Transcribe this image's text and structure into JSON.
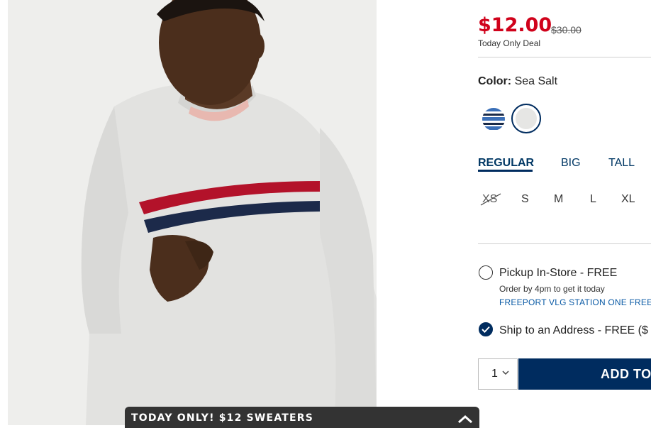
{
  "product": {
    "image_alt": "man wearing light gray crew-neck sweater with red and navy chest stripes"
  },
  "price": {
    "sale": "$12.00",
    "original": "$30.00",
    "note": "Today Only Deal"
  },
  "color": {
    "label": "Color:",
    "value": "Sea Salt",
    "swatches": [
      "blue-stripe",
      "sea-salt"
    ]
  },
  "fits": [
    "REGULAR",
    "BIG",
    "TALL"
  ],
  "sizes": [
    "XS",
    "S",
    "M",
    "L",
    "XL"
  ],
  "fulfillment": {
    "pickup": {
      "label": "Pickup In-Store - FREE",
      "note": "Order by 4pm to get it today",
      "store": "FREEPORT VLG STATION ONE FREEP"
    },
    "ship": {
      "label": "Ship to an Address - FREE ($"
    }
  },
  "cart": {
    "quantity": "1",
    "add_label": "ADD TO"
  },
  "promo": {
    "text": "TODAY ONLY! $12 SWEATERS"
  },
  "colors": {
    "accent": "#002c5f",
    "sale": "#d0021b",
    "promo_bg": "#333333"
  }
}
